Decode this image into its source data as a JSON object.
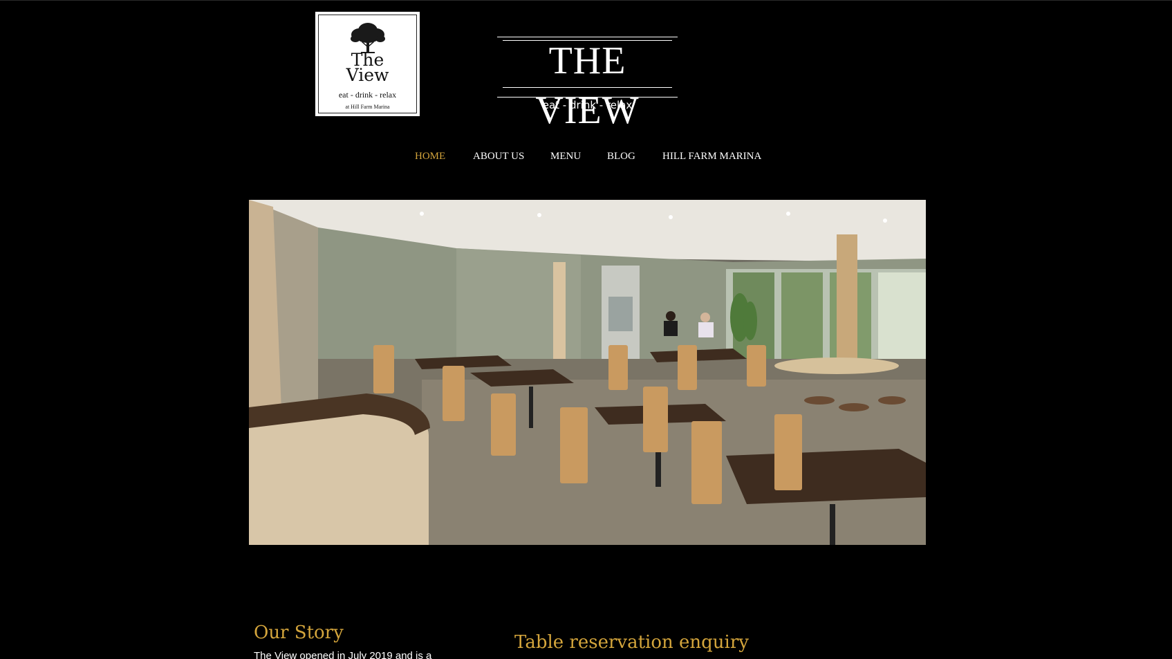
{
  "logo": {
    "name_line1": "The",
    "name_line2": "View",
    "tagline": "eat - drink - relax",
    "subline": "at Hill Farm Marina",
    "icon": "tree-icon"
  },
  "header": {
    "title": "THE VIEW",
    "tagline": "eat - drink - relax"
  },
  "nav": {
    "items": [
      {
        "label": "HOME",
        "active": true
      },
      {
        "label": "ABOUT US",
        "active": false
      },
      {
        "label": "MENU",
        "active": false
      },
      {
        "label": "BLOG",
        "active": false
      },
      {
        "label": "HILL FARM MARINA",
        "active": false
      }
    ]
  },
  "story": {
    "heading": "Our Story",
    "text": "The View opened in July 2019 and is a"
  },
  "reservation": {
    "heading": "Table reservation enquiry"
  },
  "colors": {
    "background": "#000000",
    "accent": "#d4a53c",
    "text": "#ffffff"
  }
}
